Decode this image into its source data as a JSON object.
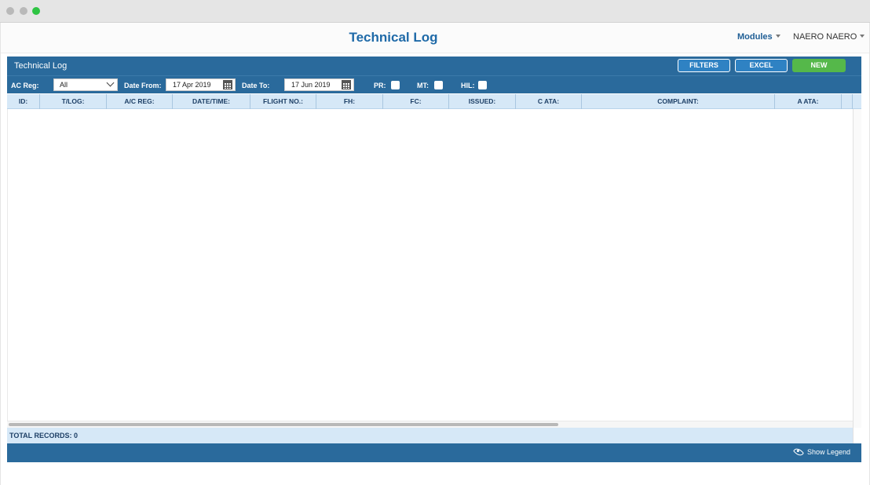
{
  "app": {
    "title": "Technical Log",
    "modules_label": "Modules",
    "user_label": "NAERO NAERO"
  },
  "panel": {
    "title": "Technical Log",
    "buttons": {
      "filters": "FILTERS",
      "excel": "EXCEL",
      "new": "NEW"
    }
  },
  "filters": {
    "ac_reg_label": "AC Reg:",
    "ac_reg_value": "All",
    "date_from_label": "Date From:",
    "date_from_value": "17 Apr 2019",
    "date_to_label": "Date To:",
    "date_to_value": "17 Jun 2019",
    "pr_label": "PR:",
    "mt_label": "MT:",
    "hil_label": "HIL:"
  },
  "table": {
    "columns": [
      "ID:",
      "T/LOG:",
      "A/C REG:",
      "DATE/TIME:",
      "FLIGHT NO.:",
      "FH:",
      "FC:",
      "ISSUED:",
      "C ATA:",
      "COMPLAINT:",
      "A ATA:"
    ],
    "rows": []
  },
  "footer": {
    "total_records": "TOTAL RECORDS: 0",
    "show_legend": "Show Legend"
  },
  "colors": {
    "primary": "#2a6a9c",
    "button_blue": "#2f82c3",
    "button_green": "#55b84a",
    "header_light": "#d6e8f7",
    "title_blue": "#1f6aa8"
  }
}
